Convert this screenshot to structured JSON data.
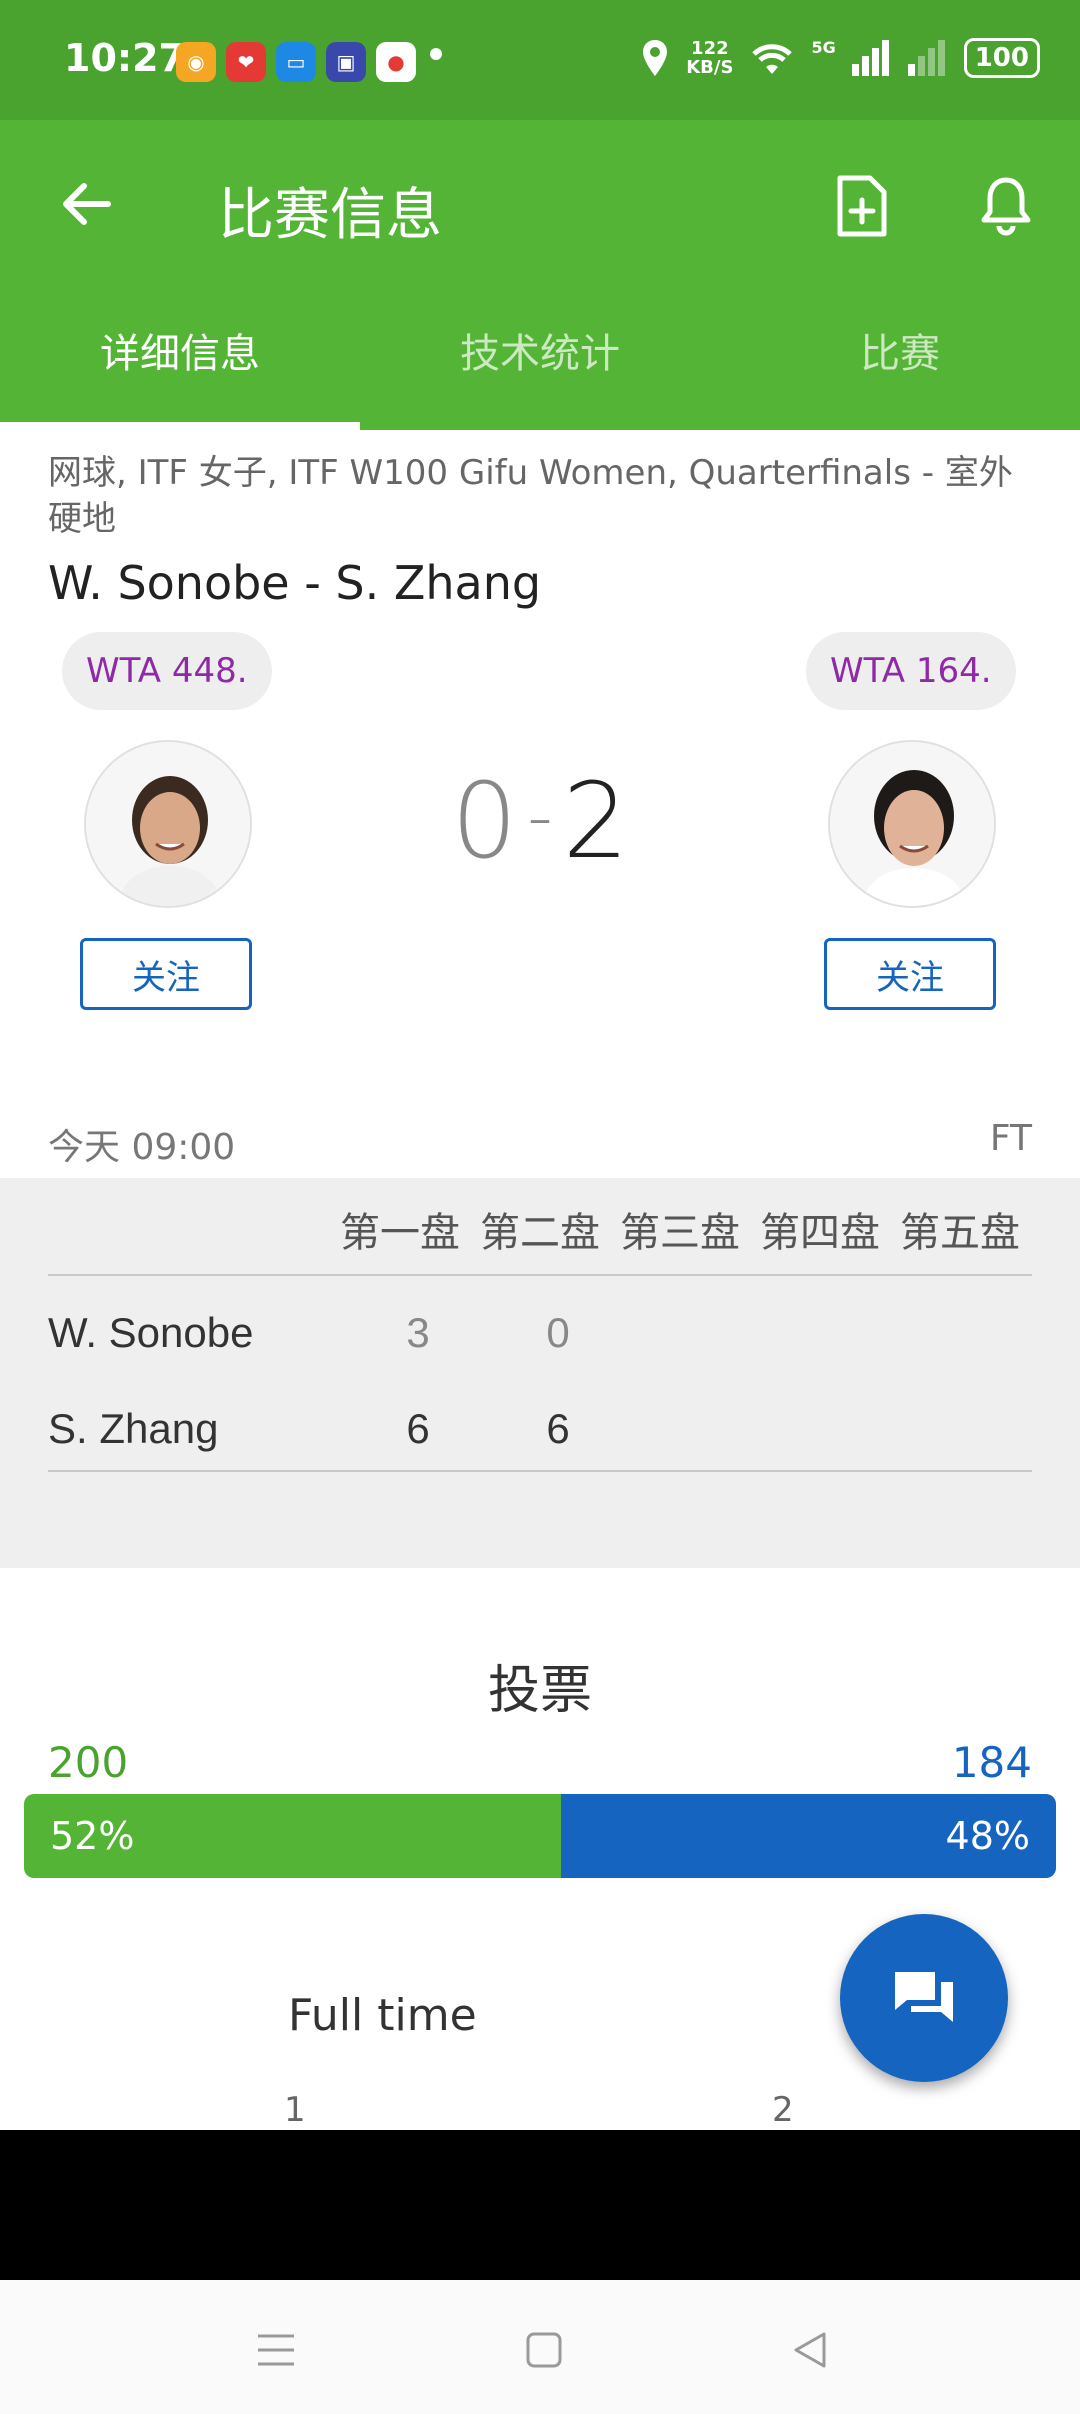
{
  "status_bar": {
    "time": "10:27",
    "net_speed_value": "122",
    "net_speed_unit": "KB/S",
    "network_type": "5G",
    "battery": "100"
  },
  "app_bar": {
    "title": "比赛信息"
  },
  "tabs": [
    {
      "label": "详细信息",
      "active": true
    },
    {
      "label": "技术统计",
      "active": false
    },
    {
      "label": "比赛",
      "active": false
    }
  ],
  "match": {
    "breadcrumb": "网球, ITF 女子, ITF W100 Gifu Women, Quarterfinals - 室外硬地",
    "title": "W. Sonobe - S. Zhang",
    "home": {
      "rank": "WTA 448.",
      "follow_label": "关注"
    },
    "away": {
      "rank": "WTA 164.",
      "follow_label": "关注"
    },
    "score_home": "0",
    "score_separator": "-",
    "score_away": "2",
    "date": "今天 09:00",
    "status": "FT"
  },
  "sets": {
    "headers": [
      "第一盘",
      "第二盘",
      "第三盘",
      "第四盘",
      "第五盘"
    ],
    "rows": [
      {
        "name": "W. Sonobe",
        "scores": [
          "3",
          "0"
        ]
      },
      {
        "name": "S. Zhang",
        "scores": [
          "6",
          "6"
        ]
      }
    ]
  },
  "vote": {
    "title": "投票",
    "home_count": "200",
    "away_count": "184",
    "home_pct_label": "52%",
    "away_pct_label": "48%",
    "home_fraction": 0.52
  },
  "fulltime": {
    "title": "Full time",
    "col1": "1",
    "col2": "2"
  },
  "colors": {
    "brand_green": "#54b435",
    "status_green": "#4aa22f",
    "accent_blue": "#1565c0",
    "rank_purple": "#8e2aa5"
  }
}
